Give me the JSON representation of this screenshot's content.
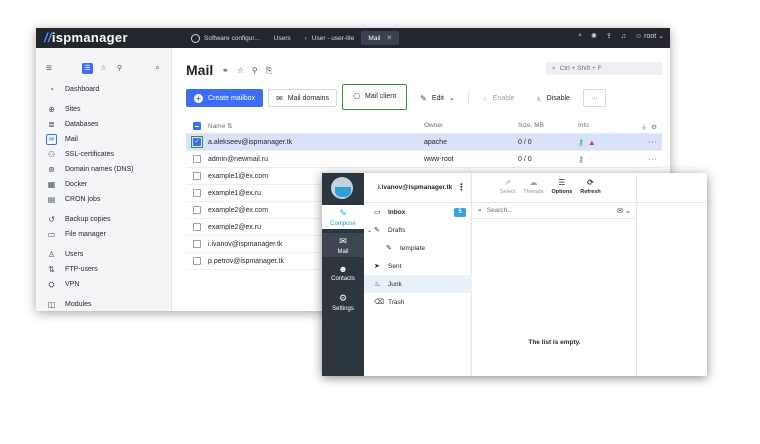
{
  "isp": {
    "logo": "ispmanager",
    "tabs": [
      {
        "label": "Software configur..."
      },
      {
        "label": "Users"
      },
      {
        "label": "User - user-lite"
      },
      {
        "label": "Mail"
      }
    ],
    "user": "root",
    "sidebar": [
      {
        "label": "Dashboard",
        "icon": "dashboard-icon"
      },
      {
        "label": "Sites",
        "icon": "globe-icon"
      },
      {
        "label": "Databases",
        "icon": "database-icon"
      },
      {
        "label": "Mail",
        "icon": "mail-icon"
      },
      {
        "label": "SSL-certificates",
        "icon": "certificate-icon"
      },
      {
        "label": "Domain names (DNS)",
        "icon": "dns-icon"
      },
      {
        "label": "Docker",
        "icon": "docker-icon"
      },
      {
        "label": "CRON jobs",
        "icon": "cron-icon"
      },
      {
        "label": "Backup copies",
        "icon": "backup-icon"
      },
      {
        "label": "File manager",
        "icon": "folder-icon"
      },
      {
        "label": "Users",
        "icon": "user-icon"
      },
      {
        "label": "FTP-users",
        "icon": "ftp-icon"
      },
      {
        "label": "VPN",
        "icon": "vpn-icon"
      },
      {
        "label": "Modules",
        "icon": "modules-icon"
      }
    ],
    "page_title": "Mail",
    "search_placeholder": "Ctrl + Shift + F",
    "toolbar": {
      "create": "Create mailbox",
      "domains": "Mail domains",
      "client": "Mail client",
      "edit": "Edit",
      "enable": "Enable",
      "disable": "Disable",
      "more": "···"
    },
    "columns": {
      "name": "Name",
      "owner": "Owner",
      "size": "Size, MB",
      "info": "Info"
    },
    "rows": [
      {
        "name": "a.alekseev@ispmanager.tk",
        "owner": "apache",
        "size": "0 / 0"
      },
      {
        "name": "admin@newmail.ru",
        "owner": "www-root",
        "size": "0 / 0"
      },
      {
        "name": "example1@ex.com",
        "owner": "",
        "size": ""
      },
      {
        "name": "example1@ex.ru",
        "owner": "",
        "size": ""
      },
      {
        "name": "example2@ex.com",
        "owner": "",
        "size": ""
      },
      {
        "name": "example2@ex.ru",
        "owner": "",
        "size": ""
      },
      {
        "name": "i.ivanov@ispmanager.tk",
        "owner": "",
        "size": ""
      },
      {
        "name": "p.petrov@ispmanager.tk",
        "owner": "",
        "size": ""
      }
    ]
  },
  "mailclient": {
    "nav": [
      {
        "label": "Compose",
        "icon": "compose-icon"
      },
      {
        "label": "Mail",
        "icon": "envelope-icon"
      },
      {
        "label": "Contacts",
        "icon": "contacts-icon"
      },
      {
        "label": "Settings",
        "icon": "gear-icon"
      }
    ],
    "user": "i.ivanov@ispmanager.tk",
    "folders": [
      {
        "label": "Inbox",
        "badge": "5"
      },
      {
        "label": "Drafts"
      },
      {
        "label": "template"
      },
      {
        "label": "Sent"
      },
      {
        "label": "Junk"
      },
      {
        "label": "Trash"
      }
    ],
    "tools": {
      "select": "Select",
      "threads": "Threads",
      "options": "Options",
      "refresh": "Refresh"
    },
    "search_placeholder": "Search...",
    "empty": "The list is empty."
  },
  "colors": {
    "accent": "#3b6ef5",
    "highlight": "#2e9a3a",
    "nav_bg": "#2c363f",
    "badge": "#37a5dd"
  }
}
